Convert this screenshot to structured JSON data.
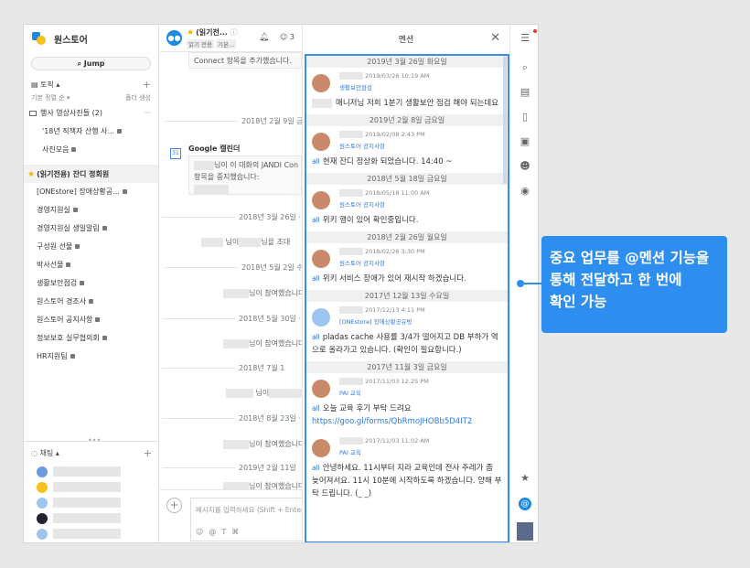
{
  "team": {
    "name": "원스토어",
    "jump_label": "Jump"
  },
  "topics": {
    "header": "토픽",
    "sort_label": "기본 정렬 순",
    "folder_create": "폴더 생성",
    "items": [
      {
        "label": "행사 영상사진들 (2)",
        "kind": "folder"
      },
      {
        "label": "'18년 직책자 산행 사...",
        "kind": "indent"
      },
      {
        "label": "사진모음",
        "kind": "indent"
      },
      {
        "label": "(읽기전용) 잔디 정회원",
        "kind": "active"
      },
      {
        "label": "[ONEstore] 장애상황공...",
        "kind": "normal"
      },
      {
        "label": "경영지원실",
        "kind": "normal"
      },
      {
        "label": "경영지원실 생일알림",
        "kind": "normal"
      },
      {
        "label": "구성원 선물",
        "kind": "normal"
      },
      {
        "label": "박사선물",
        "kind": "normal"
      },
      {
        "label": "생활보안점검",
        "kind": "normal"
      },
      {
        "label": "원스토어 경조사",
        "kind": "normal"
      },
      {
        "label": "원스토어 공지사항",
        "kind": "normal"
      },
      {
        "label": "정보보호 실무협의회",
        "kind": "normal"
      },
      {
        "label": "HR지원팀",
        "kind": "normal"
      }
    ]
  },
  "chat": {
    "header": "채팅"
  },
  "middle": {
    "title": "(읽기전...",
    "tags": [
      "읽기 전용",
      "기본..."
    ],
    "member_count": "3",
    "connect_text": "Connect 항목을 추가했습니다.",
    "dates": [
      "2018년 2월 9일 금",
      "2018년 3월 26일 ·",
      "2018년 5월 2일 수",
      "2018년 5월 30일 ·",
      "2018년 7월 1",
      "2018년 8월 23일 ·",
      "2019년 2월 11일 "
    ],
    "google_name": "Google 캘린더",
    "google_line1": "님이 이 대화의 JANDI Con",
    "google_line2": "항목을 중지했습니다:",
    "invite_text": "님이",
    "invite_text2": "님을 초대",
    "join_text": "님이 참여했습니다",
    "composer_placeholder": "메시지를 입력하세요 (Shift + Enter)"
  },
  "mention": {
    "title": "멘션",
    "items": [
      {
        "date": "2019년 3월 26일 화요일",
        "time": "2019/03/26 10:19 AM",
        "room": "생활보안점검",
        "text": "매니저님 저희 1분기 생활보안 점검 해야 되는데요",
        "all": false
      },
      {
        "date": "2019년 2월 8일 금요일",
        "time": "2019/02/08 2:43 PM",
        "room": "원스토어 공지사항",
        "text": "현재 잔디 정상화 되었습니다. 14:40 ~",
        "all": true
      },
      {
        "date": "2018년 5월 18일 금요일",
        "time": "2018/05/18 11:00 AM",
        "room": "원스토어 공지사항",
        "text": "위키 행이 있어 확인중입니다.",
        "all": true
      },
      {
        "date": "2018년 2월 26일 월요일",
        "time": "2018/02/26 3:30 PM",
        "room": "원스토어 공지사항",
        "text": "위키 서비스 장애가 있어 재시작 하겠습니다.",
        "all": true
      },
      {
        "date": "2017년 12월 13일 수요일",
        "time": "2017/12/13 4:11 PM",
        "room": "[ONEstore] 장애상황공유방",
        "text": "pladas cache 사용률 3/4가 떨어지고 DB 부하가 역으로 올라가고 있습니다. (확인이 필요합니다.)",
        "all": true
      },
      {
        "date": "2017년 11월 3일 금요일",
        "time": "2017/11/03 12:25 PM",
        "room": "PAI 교육",
        "text": "오늘 교육 후기 부탁 드려요",
        "link": "https://goo.gl/forms/QbRmoJHOBb5D4IT2",
        "all": true
      },
      {
        "date": "",
        "time": "2017/11/03 11:02 AM",
        "room": "PAI 교육",
        "text": "안녕하세요. 11시부터 지라 교육인데 전사 주레가 좀 늦어져서요. 11시 10분에 시작하도록 하겠습니다. 양해 부탁 드립니다. (_ _)",
        "all": true
      }
    ]
  },
  "callout": {
    "line1": "중요 업무를 @멘션 기능을",
    "line2": "통해 전달하고 한 번에",
    "line3": "확인 가능"
  },
  "colors": {
    "accent": "#2e8ef0",
    "link": "#2c7be5"
  }
}
